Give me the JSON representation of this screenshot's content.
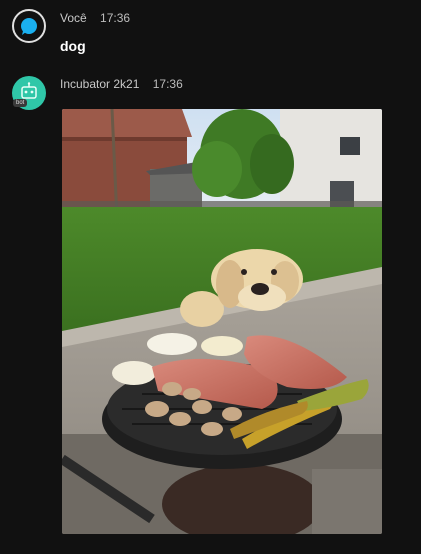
{
  "messages": [
    {
      "author": "Você",
      "time": "17:36",
      "text": "dog",
      "avatar_icon": "chat-bubble-icon"
    },
    {
      "author": "Incubator 2k21",
      "time": "17:36",
      "bot_badge": "bot",
      "avatar_icon": "robot-icon",
      "attachment": "image"
    }
  ],
  "colors": {
    "background": "#111111",
    "user_avatar": "#1ab0f0",
    "bot_avatar": "#2fc7a8"
  }
}
